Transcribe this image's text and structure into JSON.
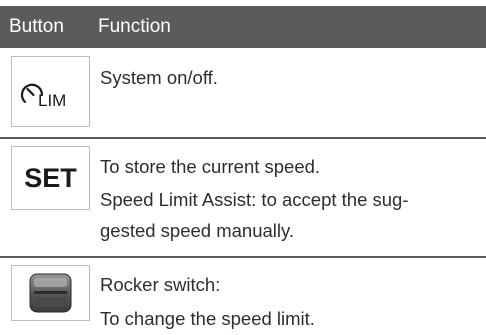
{
  "header": {
    "col_button": "Button",
    "col_function": "Function"
  },
  "rows": [
    {
      "icon": "speed-limiter-lim-icon",
      "icon_text": "LIM",
      "lines": [
        "System on/off."
      ]
    },
    {
      "icon": "set-button-icon",
      "icon_text": "SET",
      "lines": [
        "To store the current speed.",
        "Speed Limit Assist: to accept the sug-",
        "gested speed manually."
      ]
    },
    {
      "icon": "rocker-switch-icon",
      "lines": [
        "Rocker switch:",
        "To change the speed limit."
      ]
    }
  ]
}
